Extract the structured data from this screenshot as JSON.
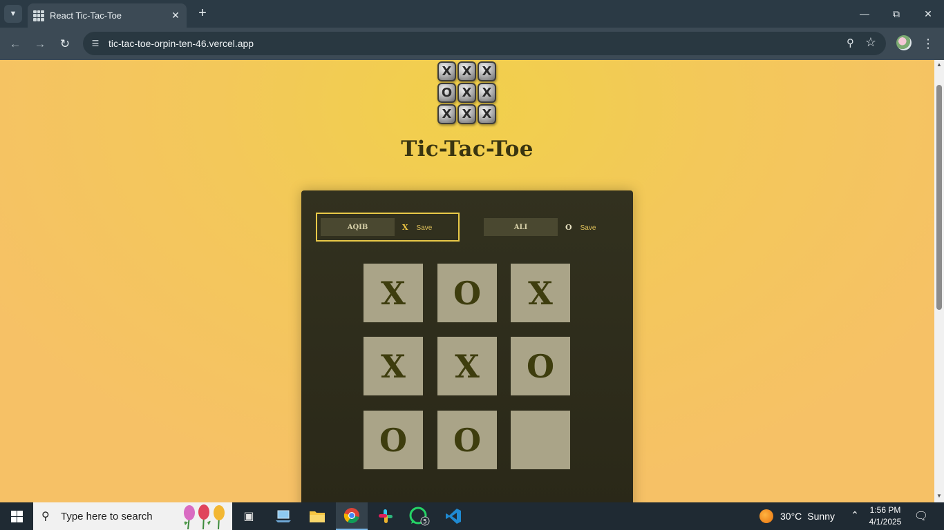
{
  "browser": {
    "tab_title": "React Tic-Tac-Toe",
    "url": "tic-tac-toe-orpin-ten-46.vercel.app",
    "icons": {
      "tab_list": "chevron-down-icon",
      "new_tab": "plus-icon",
      "back": "back-arrow-icon",
      "forward": "forward-arrow-icon",
      "reload": "reload-icon",
      "site_info": "site-info-icon",
      "zoom": "zoom-icon",
      "bookmark": "star-icon",
      "menu": "kebab-menu-icon"
    }
  },
  "page": {
    "title": "Tic-Tac-Toe",
    "logo_tiles": [
      "X",
      "X",
      "X",
      "O",
      "X",
      "X",
      "X",
      "X",
      "X"
    ],
    "background_color": "#f3c85a",
    "panel_color": "#2e2d1c",
    "active_player_border": "#e9c948"
  },
  "players": [
    {
      "name": "AQIB",
      "symbol": "X",
      "action": "Save",
      "active": true
    },
    {
      "name": "ALI",
      "symbol": "O",
      "action": "Save",
      "active": false
    }
  ],
  "board": [
    "X",
    "O",
    "X",
    "X",
    "X",
    "O",
    "O",
    "O",
    ""
  ],
  "taskbar": {
    "search_placeholder": "Type here to search",
    "apps": [
      {
        "name": "task-view-icon"
      },
      {
        "name": "laptop-icon"
      },
      {
        "name": "file-explorer-icon"
      },
      {
        "name": "chrome-icon",
        "active": true
      },
      {
        "name": "slack-icon"
      },
      {
        "name": "whatsapp-icon",
        "badge": "5"
      },
      {
        "name": "vscode-icon"
      }
    ],
    "weather": {
      "temp": "30°C",
      "condition": "Sunny"
    },
    "time": "1:56 PM",
    "date": "4/1/2025"
  }
}
